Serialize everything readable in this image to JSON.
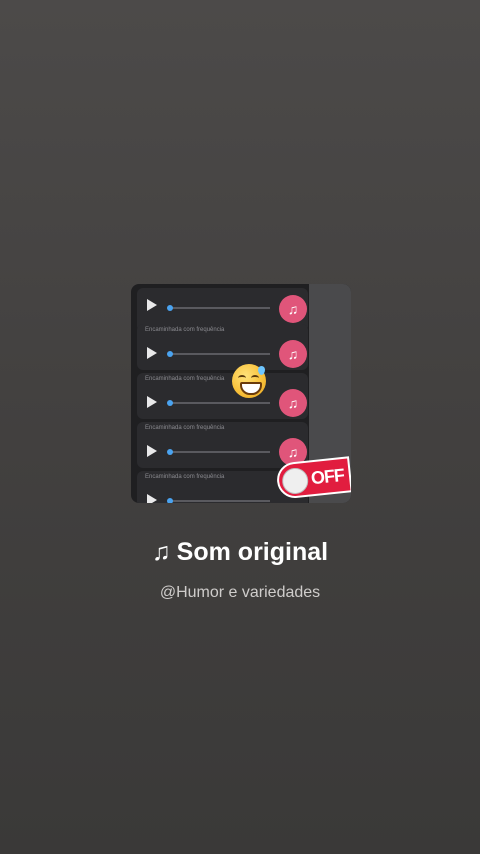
{
  "sound": {
    "note_glyph": "♫",
    "title": "Som original",
    "author": "@Humor e variedades"
  },
  "cover": {
    "messages": [
      {
        "forwarded": "",
        "time_left": "",
        "time_right": ""
      },
      {
        "forwarded": "Encaminhada com frequência",
        "time_left": "",
        "time_right": ""
      },
      {
        "forwarded": "Encaminhada com frequência",
        "time_left": "",
        "time_right": ""
      },
      {
        "forwarded": "Encaminhada com frequência",
        "time_left": "",
        "time_right": ""
      },
      {
        "forwarded": "Encaminhada com frequência",
        "time_left": "",
        "time_right": ""
      }
    ],
    "music_icon_glyph": "♫",
    "sticker_text": "OFF",
    "colors": {
      "music_icon_bg": "#e0557a",
      "progress_dot": "#4aa3f0",
      "sticker_bg": "#e11d3f"
    }
  }
}
